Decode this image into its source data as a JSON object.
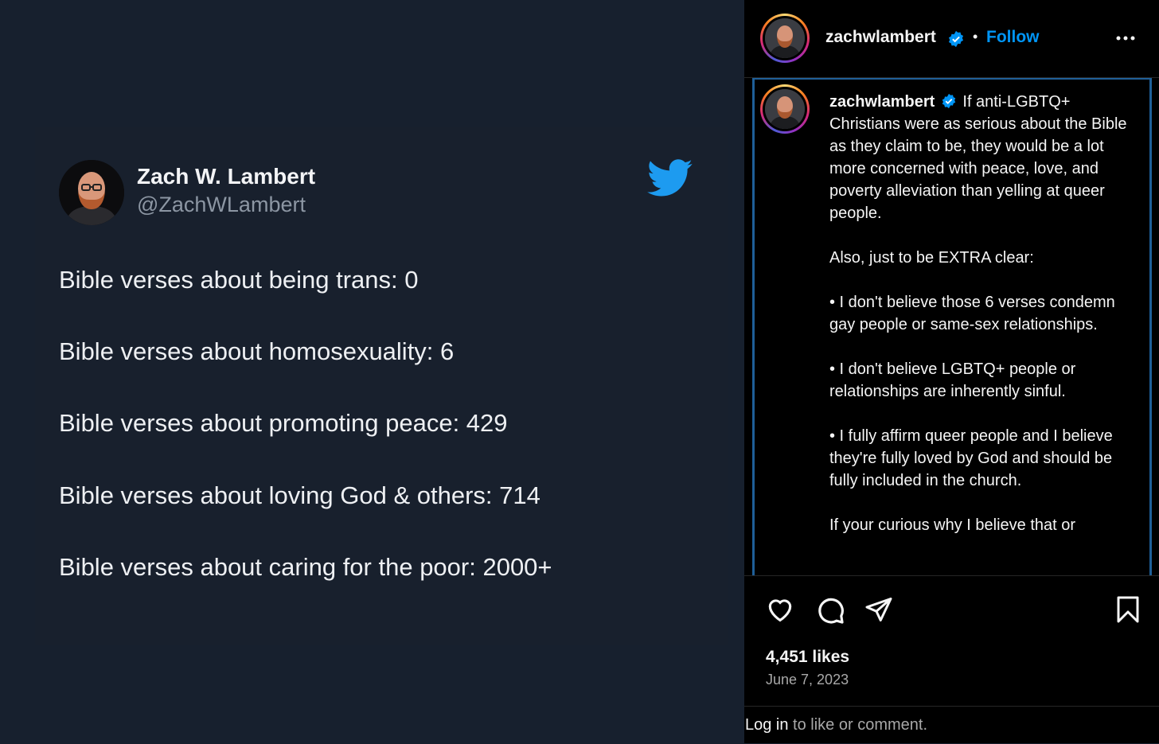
{
  "tweet": {
    "name": "Zach W. Lambert",
    "handle": "@ZachWLambert",
    "lines": [
      "Bible verses about being trans: 0",
      "Bible verses about homosexuality: 6",
      "Bible verses about promoting peace: 429",
      "Bible verses about loving God & others: 714",
      "Bible verses about caring for the poor: 2000+"
    ],
    "logo_icon": "twitter-bird-icon",
    "colors": {
      "background": "#17202e",
      "twitter_blue": "#1d9bf0"
    }
  },
  "instagram": {
    "header": {
      "username": "zachwlambert",
      "separator": "•",
      "follow_label": "Follow",
      "more_icon": "more-horizontal-icon"
    },
    "caption": {
      "username": "zachwlambert",
      "first_line": "If anti-LGBTQ+ Christians were as serious about the Bible as they claim to be, they would be a lot more concerned with peace, love, and poverty alleviation than yelling at queer people.",
      "paragraphs": [
        "Also, just to be EXTRA clear:",
        "• I don't believe those 6 verses condemn gay people or same-sex relationships.",
        "• I don't believe LGBTQ+ people or relationships are inherently sinful.",
        "• I fully affirm queer people and I believe they're fully loved by God and should be fully included in the church.",
        "If your curious why I believe that or"
      ]
    },
    "actions": {
      "icons": [
        "heart-icon",
        "comment-icon",
        "share-icon",
        "bookmark-icon"
      ],
      "likes": "4,451 likes",
      "date": "June 7, 2023",
      "login_link": "Log in",
      "login_rest": " to like or comment."
    },
    "colors": {
      "follow_blue": "#0095f6",
      "verified_blue": "#0095f6"
    }
  }
}
